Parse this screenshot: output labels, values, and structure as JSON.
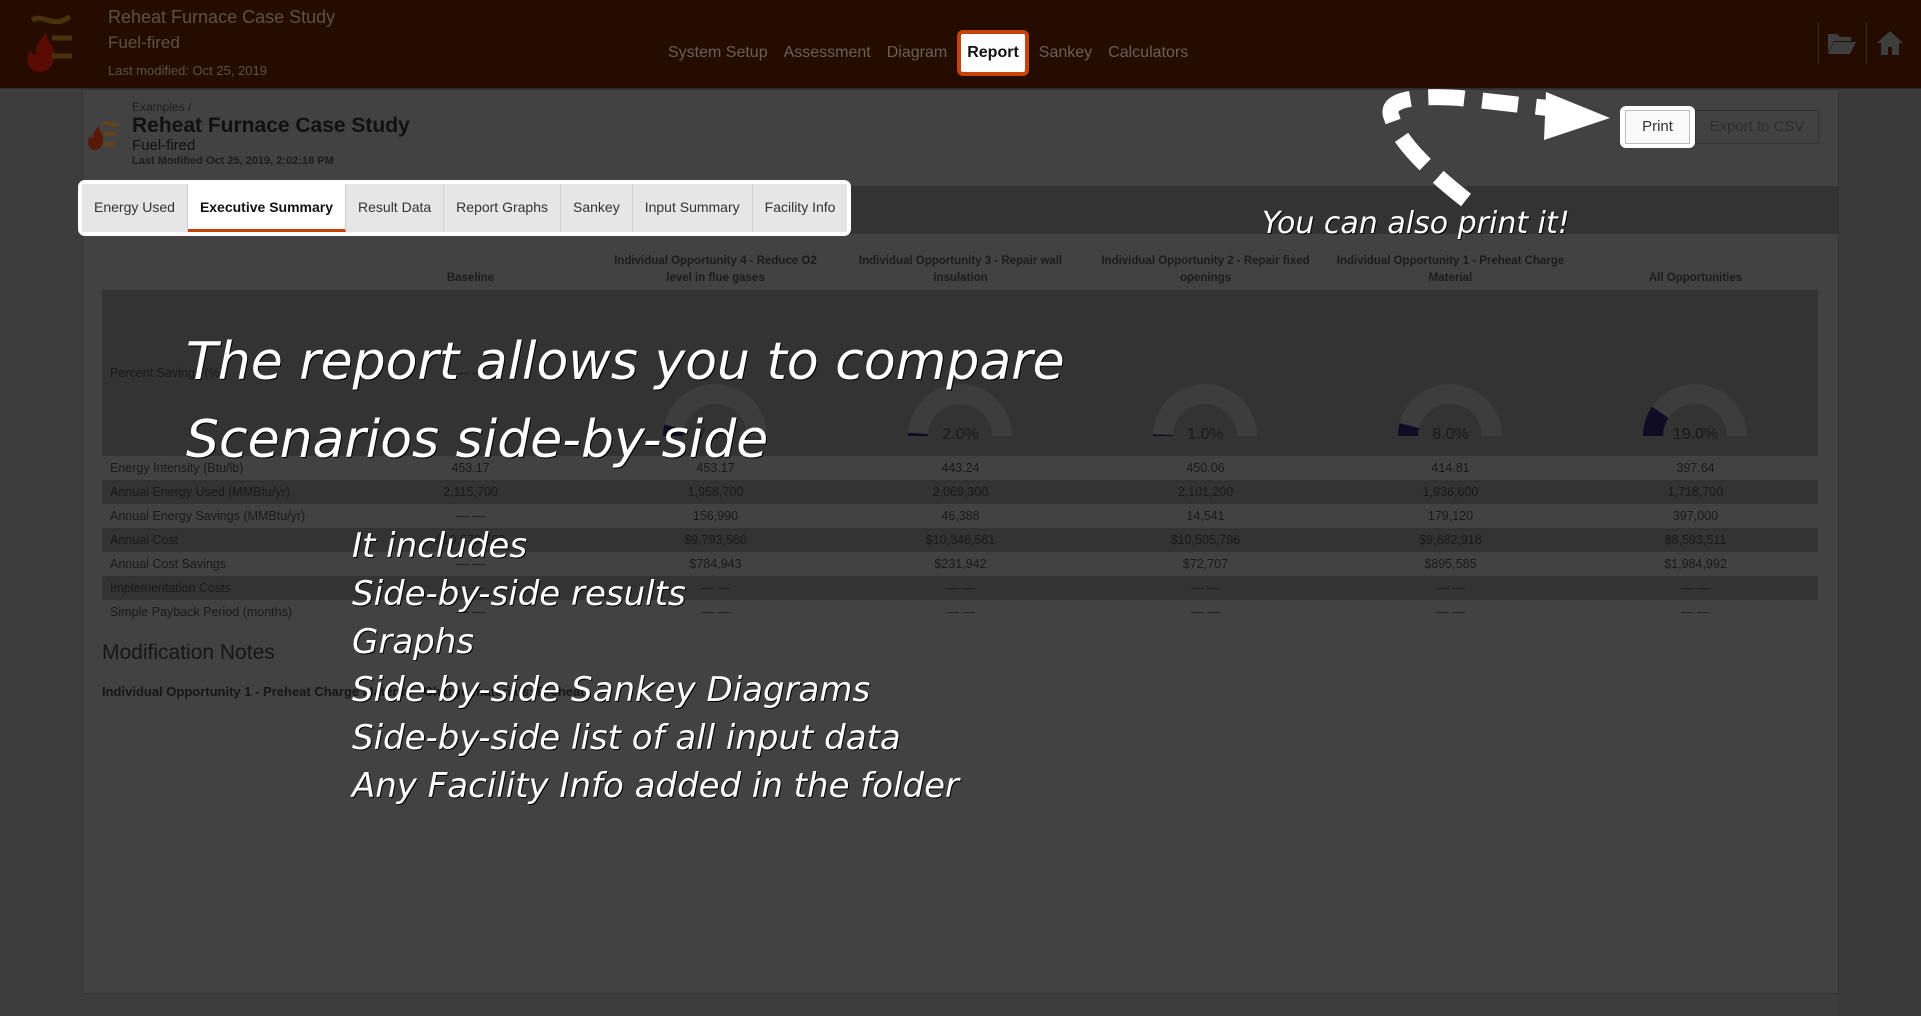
{
  "header": {
    "title": "Reheat Furnace Case Study",
    "subtitle": "Fuel-fired",
    "modified": "Last modified: Oct 25, 2019",
    "nav": [
      "System Setup",
      "Assessment",
      "Diagram",
      "Report",
      "Sankey",
      "Calculators"
    ],
    "active_nav": "Report",
    "icons": [
      "folder-open-icon",
      "home-icon"
    ]
  },
  "page": {
    "breadcrumb": "Examples /",
    "title": "Reheat Furnace Case Study",
    "subtitle": "Fuel-fired",
    "modified": "Last Modified Oct 25, 2019, 2:02:18 PM",
    "print_label": "Print",
    "export_label": "Export to CSV",
    "tabs": [
      "Energy Used",
      "Executive Summary",
      "Result Data",
      "Report Graphs",
      "Sankey",
      "Input Summary",
      "Facility Info"
    ],
    "active_tab": "Executive Summary"
  },
  "table": {
    "columns": [
      "Baseline",
      "Individual Opportunity 4 - Reduce O2 level in flue gases",
      "Individual Opportunity 3 - Repair wall insulation",
      "Individual Opportunity 2 - Repair fixed openings",
      "Individual Opportunity 1 - Preheat Charge Material",
      "All Opportunities"
    ],
    "percent_label": "Percent Savings (%)",
    "percent_savings": [
      null,
      7.0,
      2.0,
      1.0,
      8.0,
      19.0
    ],
    "percent_text": [
      "— —",
      "7.0%",
      "2.0%",
      "1.0%",
      "8.0%",
      "19.0%"
    ],
    "gauge_colors": {
      "track": "#3d3d3d",
      "fill": "#100c25"
    },
    "rows": [
      {
        "label": "Energy Intensity (Btu/lb)",
        "values": [
          "453.17",
          "453.17",
          "443.24",
          "450.06",
          "414.81",
          "397.64"
        ]
      },
      {
        "label": "Annual Energy Used (MMBtu/yr)",
        "values": [
          "2,115,700",
          "1,958,700",
          "2,069,300",
          "2,101,200",
          "1,936,600",
          "1,718,700"
        ]
      },
      {
        "label": "Annual Energy Savings (MMBtu/yr)",
        "values": [
          "— —",
          "156,990",
          "46,388",
          "14,541",
          "179,120",
          "397,000"
        ]
      },
      {
        "label": "Annual Cost",
        "values": [
          "$10,578,503",
          "$9,793,560",
          "$10,346,561",
          "$10,505,796",
          "$9,682,918",
          "$8,593,511"
        ]
      },
      {
        "label": "Annual Cost Savings",
        "values": [
          "— —",
          "$784,943",
          "$231,942",
          "$72,707",
          "$895,585",
          "$1,984,992"
        ]
      },
      {
        "label": "Implementation Costs",
        "values": [
          "— —",
          "— —",
          "— —",
          "— —",
          "— —",
          "— —"
        ]
      },
      {
        "label": "Simple Payback Period (months)",
        "values": [
          "— —",
          "— —",
          "— —",
          "— —",
          "— —",
          "— —"
        ]
      }
    ]
  },
  "notes": {
    "heading": "Modification Notes",
    "text": "Individual Opportunity 1 - Preheat Charge Material - Charge materials: Preheat"
  },
  "overlay": {
    "headline": [
      "The report allows you to compare",
      "Scenarios side-by-side"
    ],
    "includes": [
      "It includes",
      "Side-by-side results",
      "Graphs",
      "Side-by-side Sankey Diagrams",
      "Side-by-side list of all input data",
      "Any Facility Info added in the folder"
    ],
    "print_hint": "You can also print it!"
  }
}
